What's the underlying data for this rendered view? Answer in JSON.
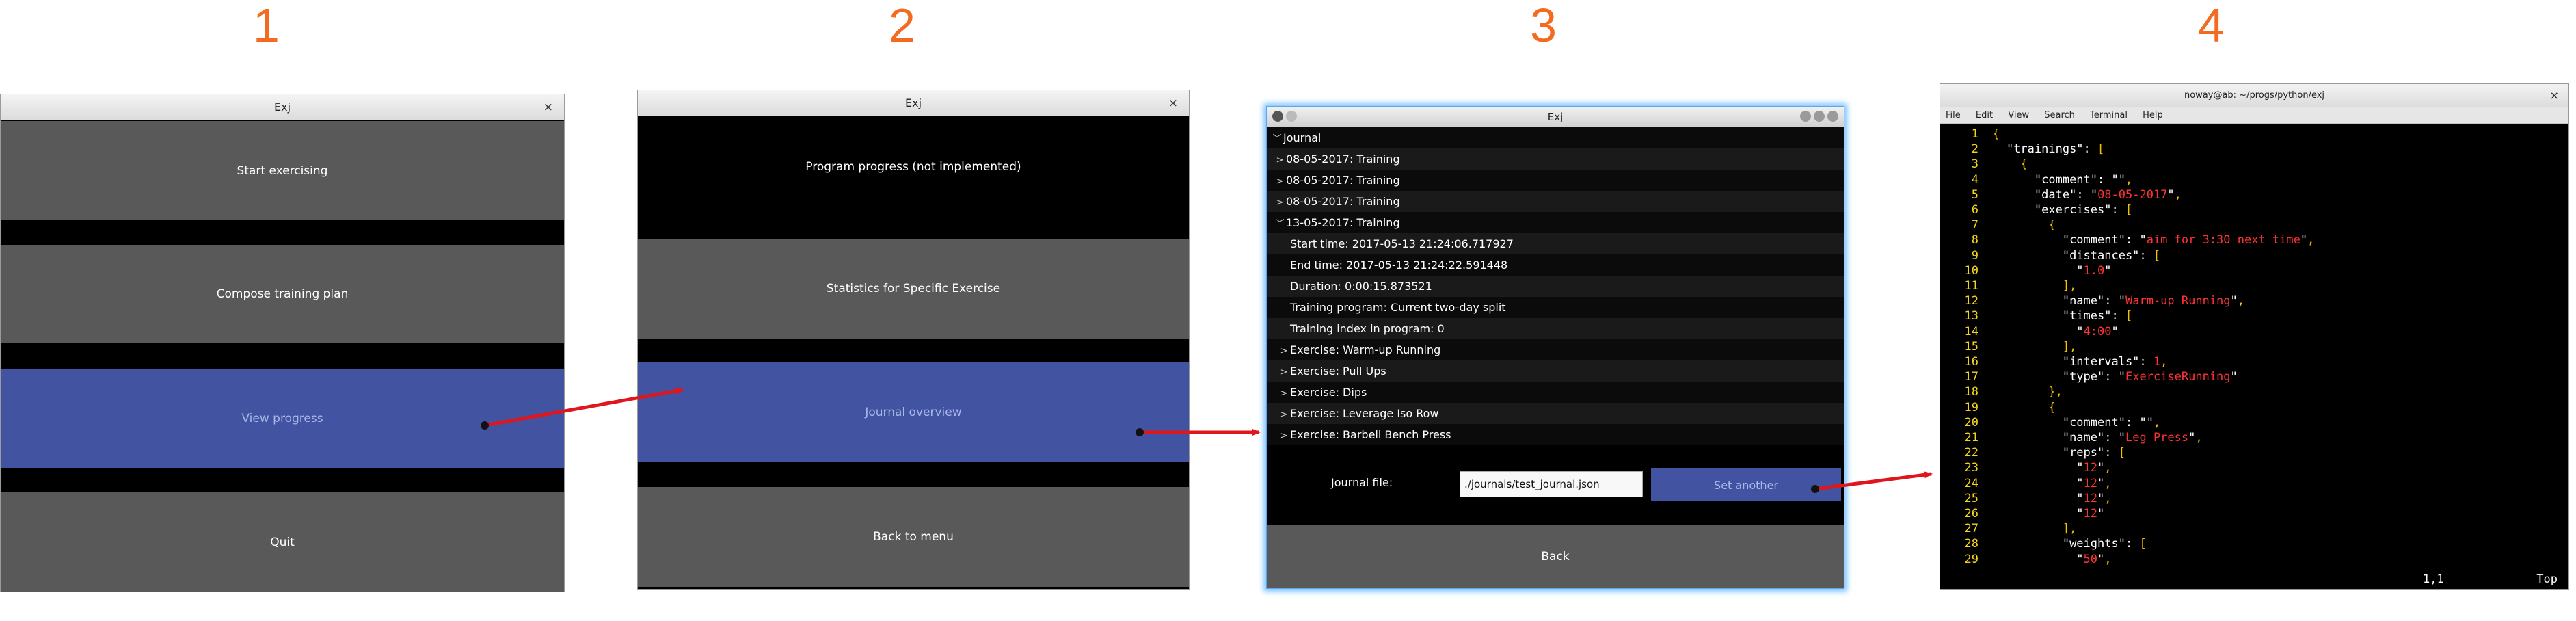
{
  "step_numbers": [
    "1",
    "2",
    "3",
    "4"
  ],
  "window1": {
    "title": "Exj",
    "close": "×",
    "buttons": [
      "Start exercising",
      "Compose training plan",
      "View progress",
      "Quit"
    ]
  },
  "window2": {
    "title": "Exj",
    "close": "×",
    "buttons": [
      "Program progress (not implemented)",
      "Statistics for Specific Exercise",
      "Journal overview",
      "Back to menu"
    ]
  },
  "window3": {
    "title": "Exj",
    "tree": {
      "root": "Journal",
      "trainings": [
        "08-05-2017: Training",
        "08-05-2017: Training",
        "08-05-2017: Training",
        "13-05-2017: Training"
      ],
      "details": [
        "Start time: 2017-05-13 21:24:06.717927",
        "End time: 2017-05-13 21:24:22.591448",
        "Duration: 0:00:15.873521",
        "Training program: Current two-day split",
        "Training index in program: 0"
      ],
      "exercises": [
        "Exercise: Warm-up Running",
        "Exercise: Pull Ups",
        "Exercise: Dips",
        "Exercise: Leverage Iso Row",
        "Exercise: Barbell Bench Press"
      ]
    },
    "journal_file_label": "Journal file:",
    "journal_file_value": "./journals/test_journal.json",
    "set_another": "Set another",
    "back": "Back"
  },
  "window4": {
    "title": "noway@ab: ~/progs/python/exj",
    "close": "×",
    "menu": [
      "File",
      "Edit",
      "View",
      "Search",
      "Terminal",
      "Help"
    ],
    "status_position": "1,1",
    "status_scroll": "Top",
    "lines": [
      {
        "n": "1",
        "code": "{"
      },
      {
        "n": "2",
        "code": "  \"trainings\": ["
      },
      {
        "n": "3",
        "code": "    {"
      },
      {
        "n": "4",
        "code": "      \"comment\": \"\","
      },
      {
        "n": "5",
        "code": "      \"date\": \"08-05-2017\","
      },
      {
        "n": "6",
        "code": "      \"exercises\": ["
      },
      {
        "n": "7",
        "code": "        {"
      },
      {
        "n": "8",
        "code": "          \"comment\": \"aim for 3:30 next time\","
      },
      {
        "n": "9",
        "code": "          \"distances\": ["
      },
      {
        "n": "10",
        "code": "            \"1.0\""
      },
      {
        "n": "11",
        "code": "          ],"
      },
      {
        "n": "12",
        "code": "          \"name\": \"Warm-up Running\","
      },
      {
        "n": "13",
        "code": "          \"times\": ["
      },
      {
        "n": "14",
        "code": "            \"4:00\""
      },
      {
        "n": "15",
        "code": "          ],"
      },
      {
        "n": "16",
        "code": "          \"intervals\": 1,"
      },
      {
        "n": "17",
        "code": "          \"type\": \"ExerciseRunning\""
      },
      {
        "n": "18",
        "code": "        },"
      },
      {
        "n": "19",
        "code": "        {"
      },
      {
        "n": "20",
        "code": "          \"comment\": \"\","
      },
      {
        "n": "21",
        "code": "          \"name\": \"Leg Press\","
      },
      {
        "n": "22",
        "code": "          \"reps\": ["
      },
      {
        "n": "23",
        "code": "            \"12\","
      },
      {
        "n": "24",
        "code": "            \"12\","
      },
      {
        "n": "25",
        "code": "            \"12\","
      },
      {
        "n": "26",
        "code": "            \"12\""
      },
      {
        "n": "27",
        "code": "          ],"
      },
      {
        "n": "28",
        "code": "          \"weights\": ["
      },
      {
        "n": "29",
        "code": "            \"50\","
      }
    ]
  },
  "colors": {
    "step_number": "#f26b21",
    "button_gray": "#595959",
    "button_selected": "#4253a1",
    "arrow": "#e0161d",
    "terminal_line_number": "#f5d51c",
    "terminal_string": "#ff3333"
  }
}
